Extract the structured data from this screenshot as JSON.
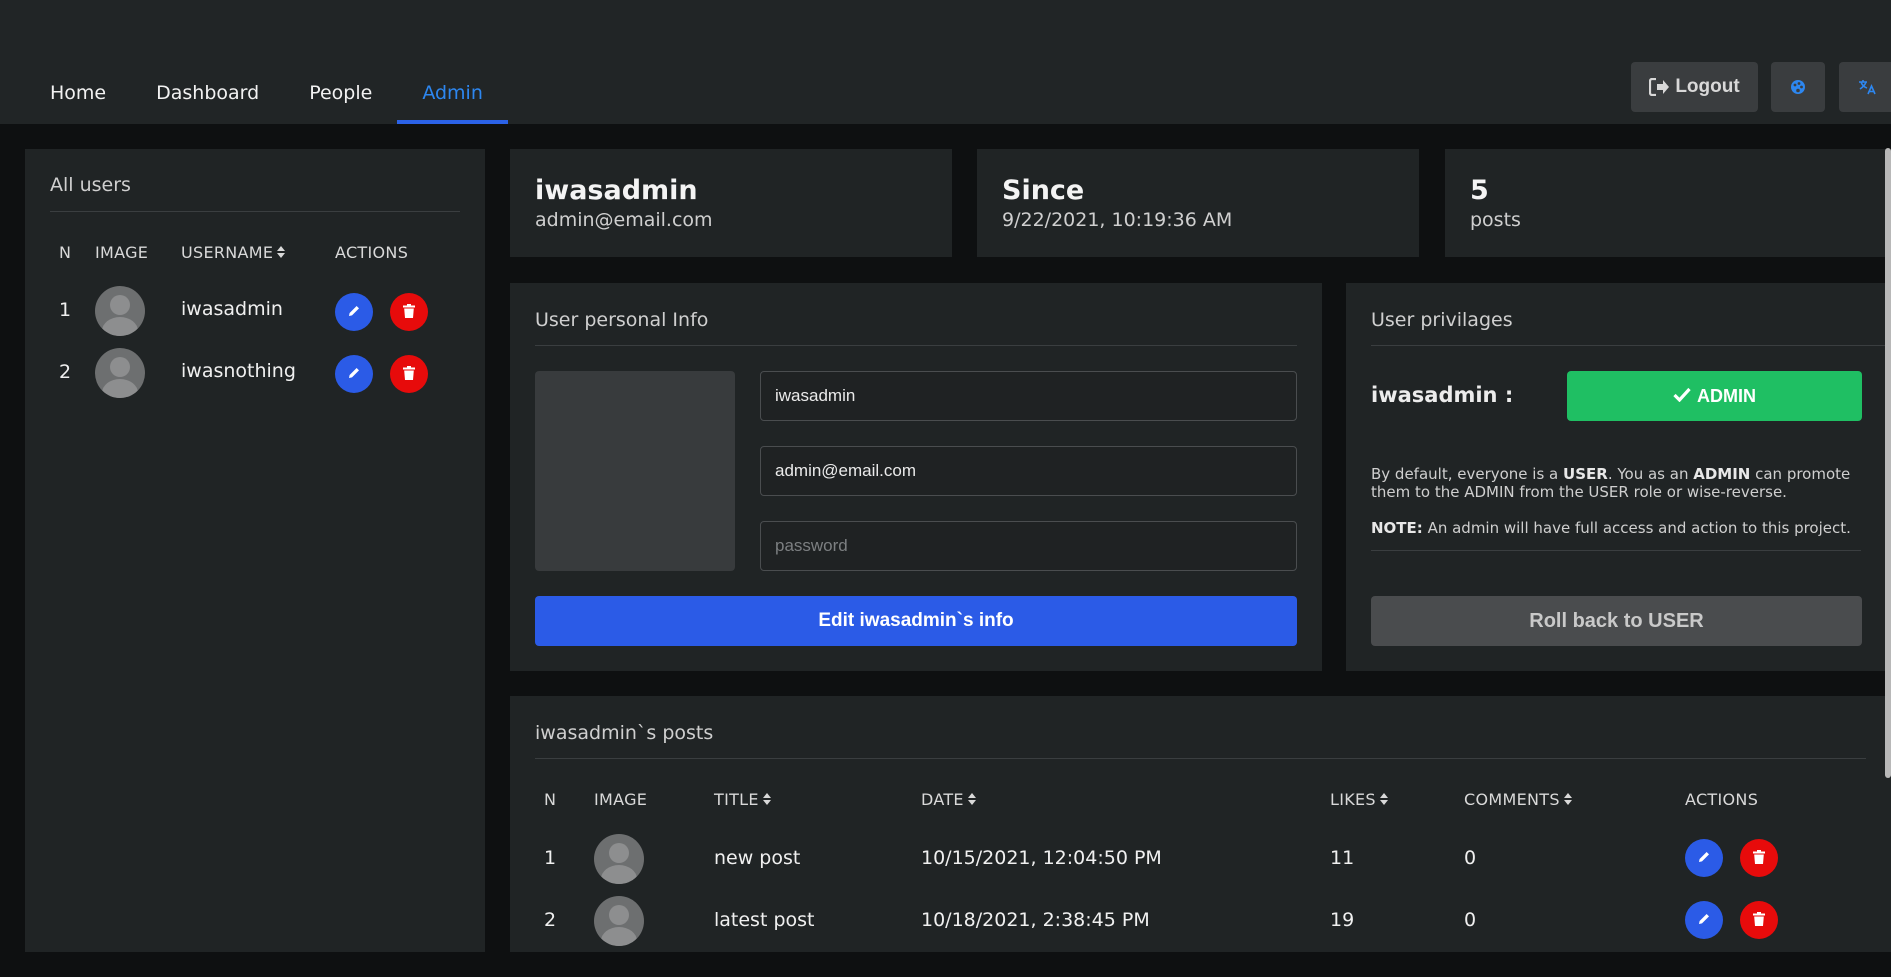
{
  "nav": {
    "items": [
      {
        "label": "Home",
        "active": false
      },
      {
        "label": "Dashboard",
        "active": false
      },
      {
        "label": "People",
        "active": false
      },
      {
        "label": "Admin",
        "active": true
      }
    ],
    "logout_label": "Logout",
    "logout_icon": "sign-out-icon",
    "theme_icon": "palette-icon",
    "language_icon": "translate-icon"
  },
  "users_panel": {
    "title": "All users",
    "columns": [
      "N",
      "IMAGE",
      "USERNAME",
      "ACTIONS"
    ],
    "rows": [
      {
        "n": "1",
        "username": "iwasadmin"
      },
      {
        "n": "2",
        "username": "iwasnothing"
      }
    ]
  },
  "profile": {
    "username": "iwasadmin",
    "email": "admin@email.com",
    "since_label": "Since",
    "since_value": "9/22/2021, 10:19:36 AM",
    "posts_count": "5",
    "posts_label": "posts"
  },
  "personal_info": {
    "title": "User personal Info",
    "username_value": "iwasadmin",
    "email_value": "admin@email.com",
    "password_placeholder": "password",
    "submit_label": "Edit iwasadmin`s info"
  },
  "privileges": {
    "title": "User privilages",
    "user_label": "iwasadmin :",
    "role_button_label": "ADMIN",
    "note_1a": "By default, everyone is a ",
    "note_1b": "USER",
    "note_1c": ". You as an ",
    "note_1d": "ADMIN",
    "note_1e": " can promote",
    "note_1f": "them to the ADMIN from the USER role or wise-reverse.",
    "note_2a": "NOTE:",
    "note_2b": " An admin will have full access and action to this project.",
    "rollback_label": "Roll back to USER"
  },
  "posts": {
    "title": "iwasadmin`s posts",
    "columns": [
      "N",
      "IMAGE",
      "TITLE",
      "DATE",
      "LIKES",
      "COMMENTS",
      "ACTIONS"
    ],
    "rows": [
      {
        "n": "1",
        "title": "new post",
        "date": "10/15/2021, 12:04:50 PM",
        "likes": "11",
        "comments": "0"
      },
      {
        "n": "2",
        "title": "latest post",
        "date": "10/18/2021, 2:38:45 PM",
        "likes": "19",
        "comments": "0"
      }
    ]
  },
  "colors": {
    "accent": "#2b5be7",
    "active_tab": "#2d87f0",
    "danger": "#e70b0b",
    "success": "#1fbf63",
    "panel": "#202425",
    "background": "#0e1011"
  }
}
